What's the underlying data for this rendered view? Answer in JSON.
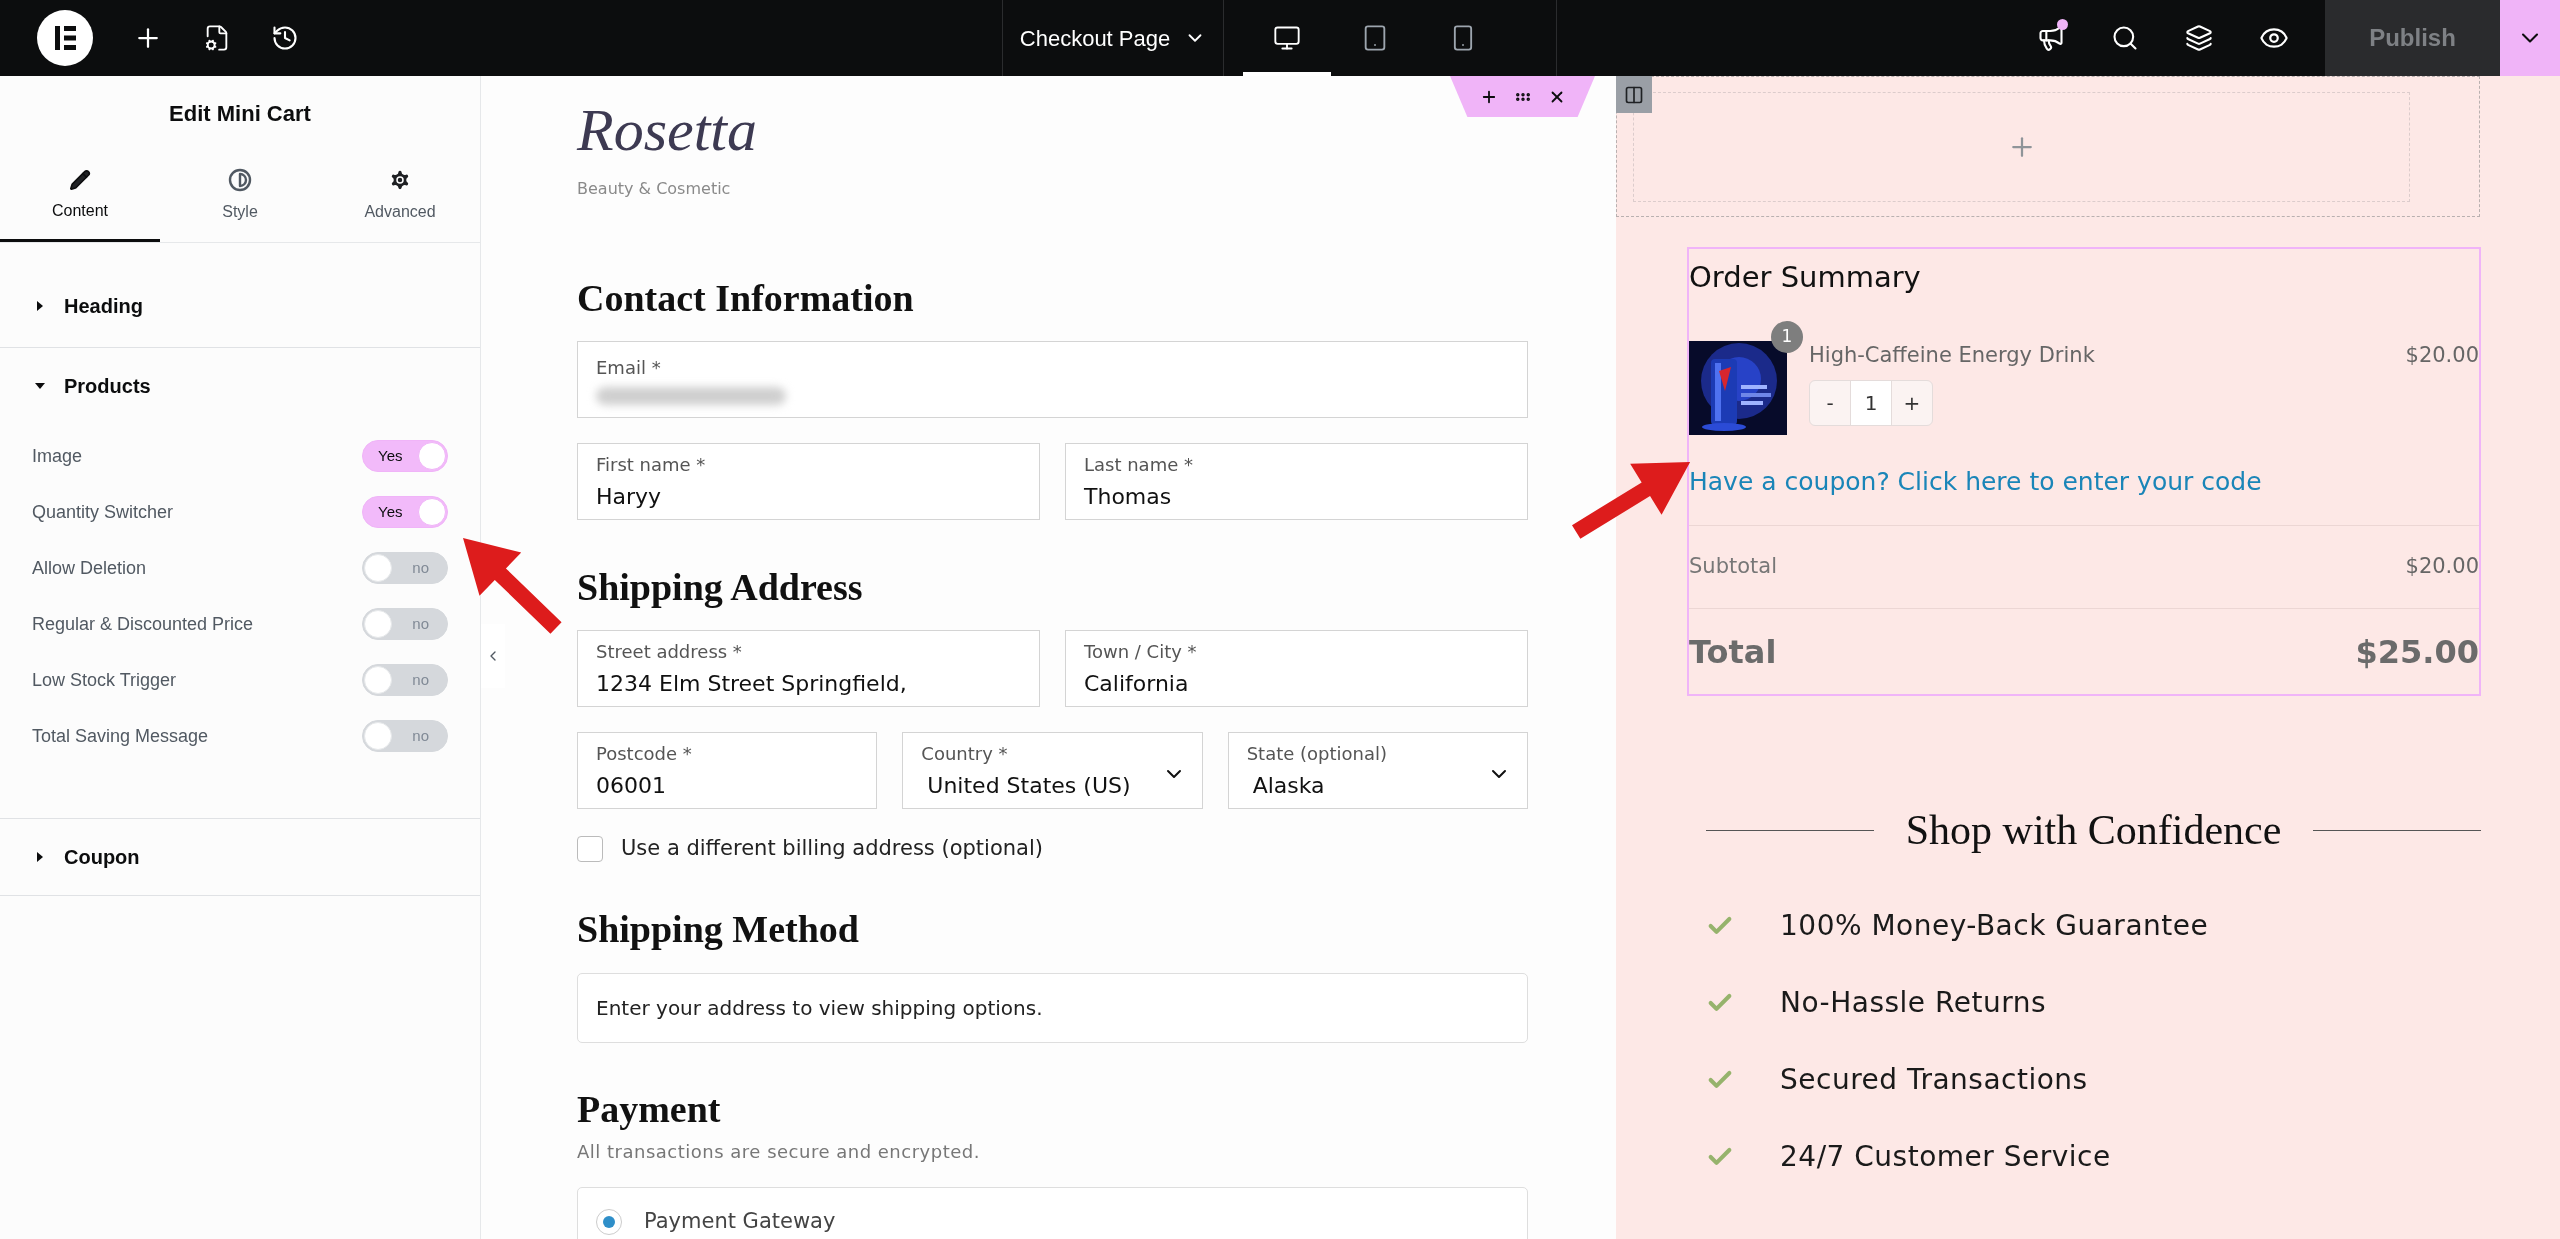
{
  "topbar": {
    "page_title": "Checkout Page",
    "devices": [
      {
        "kind": "desktop",
        "selected": true
      },
      {
        "kind": "tablet",
        "selected": false
      },
      {
        "kind": "mobile",
        "selected": false
      }
    ],
    "has_notification": true,
    "publish": "Publish"
  },
  "panel": {
    "title": "Edit Mini Cart",
    "tabs": [
      {
        "kind": "content",
        "label": "Content",
        "selected": true
      },
      {
        "kind": "style",
        "label": "Style",
        "selected": false
      },
      {
        "kind": "advanced",
        "label": "Advanced",
        "selected": false
      }
    ],
    "sections": [
      {
        "title": "Heading",
        "expanded": false
      },
      {
        "title": "Products",
        "expanded": true,
        "controls": [
          {
            "label": "Image",
            "on": true,
            "value": "Yes"
          },
          {
            "label": "Quantity Switcher",
            "on": true,
            "value": "Yes"
          },
          {
            "label": "Allow Deletion",
            "on": false,
            "value": "no"
          },
          {
            "label": "Regular & Discounted Price",
            "on": false,
            "value": "no"
          },
          {
            "label": "Low Stock Trigger",
            "on": false,
            "value": "no"
          },
          {
            "label": "Total Saving Message",
            "on": false,
            "value": "no"
          }
        ]
      },
      {
        "title": "Coupon",
        "expanded": false
      }
    ]
  },
  "site": {
    "logo": "Rosetta",
    "tagline": "Beauty & Cosmetic"
  },
  "checkout": [
    {
      "heading": "Contact Information",
      "rows": [
        [
          {
            "kind": "redacted",
            "label": "Email *"
          }
        ],
        [
          {
            "kind": "text",
            "label": "First name *",
            "value": "Haryy"
          },
          {
            "kind": "text",
            "label": "Last name *",
            "value": "Thomas"
          }
        ]
      ]
    },
    {
      "heading": "Shipping Address",
      "rows": [
        [
          {
            "kind": "text",
            "label": "Street address *",
            "value": "1234 Elm Street Springfield,"
          },
          {
            "kind": "text",
            "label": "Town / City *",
            "value": "California"
          }
        ],
        [
          {
            "kind": "text",
            "label": "Postcode *",
            "value": "06001"
          },
          {
            "kind": "select",
            "label": "Country *",
            "value": "United States (US)"
          },
          {
            "kind": "select",
            "label": "State (optional)",
            "value": "Alaska"
          }
        ]
      ],
      "checkbox": {
        "label": "Use a different billing address (optional)",
        "checked": false
      }
    },
    {
      "heading": "Shipping Method",
      "notice": "Enter your address to view shipping options."
    },
    {
      "heading": "Payment",
      "subtitle": "All transactions are secure and encrypted.",
      "options": [
        {
          "label": "Payment Gateway",
          "selected": true
        }
      ]
    }
  ],
  "order_summary": {
    "title": "Order Summary",
    "items": [
      {
        "count": "1",
        "name": "High-Caffeine Energy Drink",
        "price": "$20.00",
        "minus": "-",
        "quantity": "1",
        "plus": "+"
      }
    ],
    "coupon_link": "Have a coupon? Click here to enter your code",
    "subtotal": {
      "label": "Subtotal",
      "value": "$20.00"
    },
    "total": {
      "label": "Total",
      "value": "$25.00"
    }
  },
  "trust": {
    "heading": "Shop with Confidence",
    "items": [
      "100% Money-Back Guarantee",
      "No-Hassle Returns",
      "Secured Transactions",
      "24/7 Customer Service"
    ]
  }
}
